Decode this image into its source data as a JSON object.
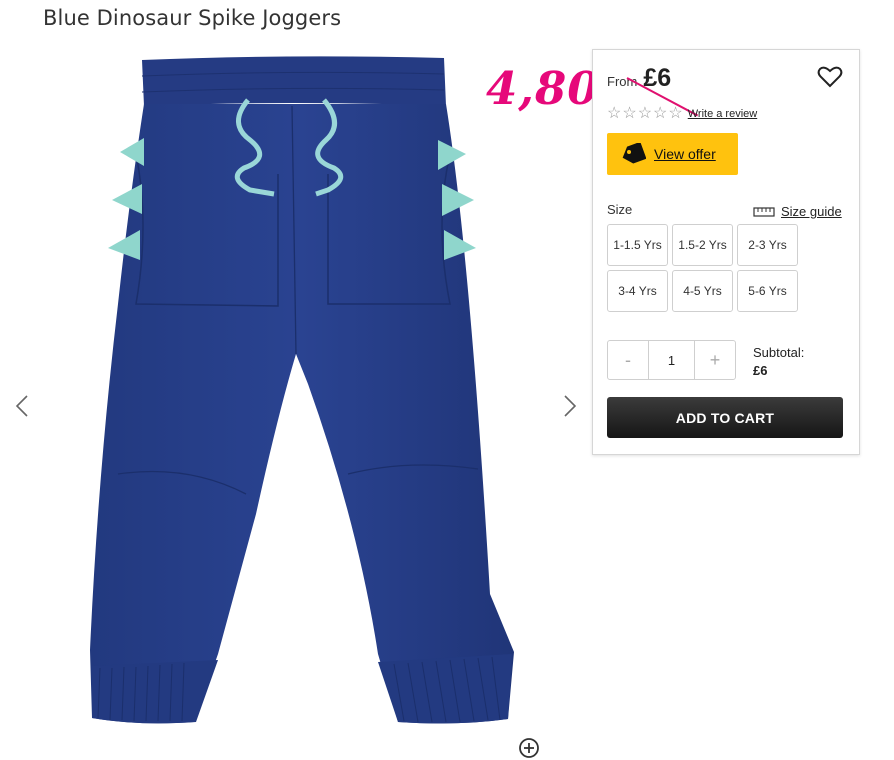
{
  "product": {
    "title": "Blue Dinosaur Spike Joggers"
  },
  "annotation": {
    "sale_price": "4,80"
  },
  "pricing": {
    "from_label": "From",
    "old_price": "£6"
  },
  "reviews": {
    "stars": [
      "☆",
      "☆",
      "☆",
      "☆",
      "☆"
    ],
    "link_label": "Write a review"
  },
  "offer": {
    "label": "View offer"
  },
  "size": {
    "label": "Size",
    "guide_label": "Size guide",
    "options": [
      "1-1.5 Yrs",
      "1.5-2 Yrs",
      "2-3 Yrs",
      "3-4 Yrs",
      "4-5 Yrs",
      "5-6 Yrs"
    ]
  },
  "quantity": {
    "minus": "-",
    "value": "1",
    "plus": "+"
  },
  "subtotal": {
    "label": "Subtotal:",
    "value": "£6"
  },
  "cart": {
    "label": "ADD TO CART"
  },
  "icons": {
    "prev": "chevron-left-icon",
    "next": "chevron-right-icon",
    "wishlist": "heart-icon",
    "offer": "price-tag-icon",
    "size_guide": "ruler-icon",
    "zoom": "zoom-icon"
  },
  "colors": {
    "product_blue": "#253b83",
    "spike_teal": "#8fd6cc",
    "offer_yellow": "#ffc20e",
    "sale_pink": "#e6087a",
    "cart_dark": "#1e1e1e"
  }
}
